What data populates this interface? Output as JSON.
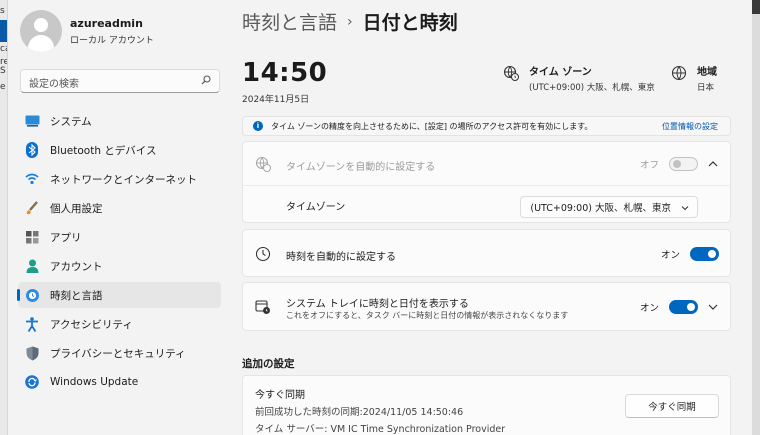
{
  "background_edge": {
    "left_text": [
      "s",
      "ca",
      "re",
      "S",
      "e"
    ]
  },
  "profile": {
    "name": "azureadmin",
    "account_type": "ローカル アカウント"
  },
  "search": {
    "placeholder": "設定の検索"
  },
  "sidebar": {
    "items": [
      {
        "label": "システム",
        "icon": "system-icon"
      },
      {
        "label": "Bluetooth とデバイス",
        "icon": "bluetooth-icon"
      },
      {
        "label": "ネットワークとインターネット",
        "icon": "wifi-icon"
      },
      {
        "label": "個人用設定",
        "icon": "brush-icon"
      },
      {
        "label": "アプリ",
        "icon": "apps-icon"
      },
      {
        "label": "アカウント",
        "icon": "account-icon"
      },
      {
        "label": "時刻と言語",
        "icon": "globe-clock-icon",
        "active": true
      },
      {
        "label": "アクセシビリティ",
        "icon": "accessibility-icon"
      },
      {
        "label": "プライバシーとセキュリティ",
        "icon": "shield-icon"
      },
      {
        "label": "Windows Update",
        "icon": "update-icon"
      }
    ]
  },
  "header": {
    "parent": "時刻と言語",
    "separator": "›",
    "current": "日付と時刻"
  },
  "clock": {
    "time": "14:50",
    "date": "2024年11月5日"
  },
  "timezone_info": {
    "title": "タイム ゾーン",
    "value": "(UTC+09:00) 大阪、札幌、東京"
  },
  "region_info": {
    "title": "地域",
    "value": "日本"
  },
  "notice": {
    "text": "タイム ゾーンの精度を向上させるために、[設定] の場所のアクセス許可を有効にします。",
    "link": "位置情報の設定"
  },
  "auto_timezone": {
    "label": "タイムゾーンを自動的に設定する",
    "state_label": "オフ",
    "enabled": false
  },
  "timezone_select": {
    "label": "タイムゾーン",
    "value": "(UTC+09:00) 大阪、札幌、東京"
  },
  "auto_time": {
    "label": "時刻を自動的に設定する",
    "state_label": "オン",
    "on": true
  },
  "tray": {
    "label": "システム トレイに時刻と日付を表示する",
    "description": "これをオフにすると、タスク バーに時刻と日付の情報が表示されなくなります",
    "state_label": "オン",
    "on": true
  },
  "additional": {
    "title": "追加の設定"
  },
  "sync": {
    "title": "今すぐ同期",
    "last_sync": "前回成功した時刻の同期:2024/11/05 14:50:46",
    "server": "タイム サーバー: VM IC Time Synchronization Provider",
    "button": "今すぐ同期"
  },
  "colors": {
    "accent": "#0067c0",
    "background": "#f3f3f3",
    "card": "#fbfbfb"
  }
}
